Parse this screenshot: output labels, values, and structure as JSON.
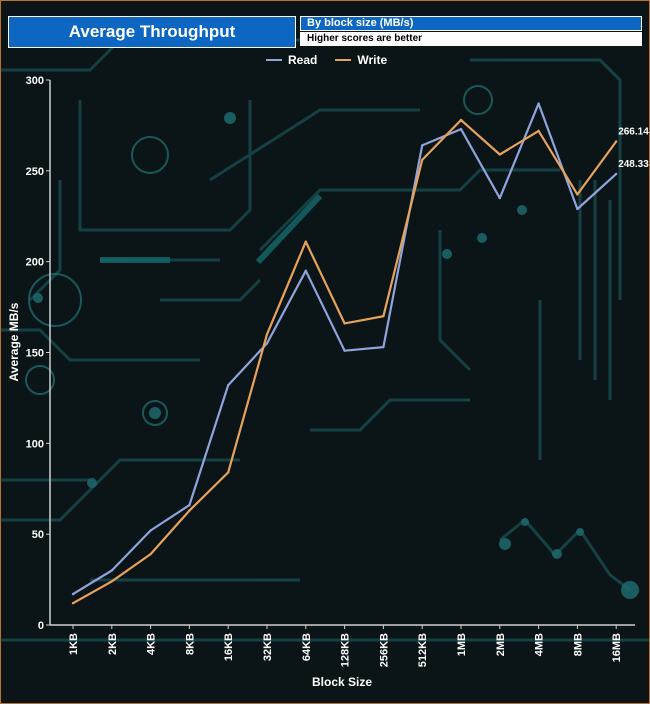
{
  "header": {
    "title": "Average Throughput",
    "subtitle": "By block size (MB/s)",
    "note": "Higher scores are better"
  },
  "colors": {
    "read": "#8fa4dc",
    "write": "#e8a35a",
    "title_bg": "#0d66c2",
    "axis": "#d0d0d0"
  },
  "chart_data": {
    "type": "line",
    "title": "Average Throughput",
    "subtitle": "By block size (MB/s)",
    "xlabel": "Block Size",
    "ylabel": "Average MB/s",
    "ylim": [
      0,
      300
    ],
    "yticks": [
      0,
      50,
      100,
      150,
      200,
      250,
      300
    ],
    "grid": false,
    "legend_position": "top-center",
    "categories": [
      "1KB",
      "2KB",
      "4KB",
      "8KB",
      "16KB",
      "32KB",
      "64KB",
      "128KB",
      "256KB",
      "512KB",
      "1MB",
      "2MB",
      "4MB",
      "8MB",
      "16MB"
    ],
    "series": [
      {
        "name": "Read",
        "values": [
          17,
          30,
          52,
          66,
          132,
          155,
          195,
          151,
          153,
          264,
          273,
          235,
          287,
          229,
          248.33
        ],
        "end_label": "248.33"
      },
      {
        "name": "Write",
        "values": [
          12,
          24,
          39,
          63,
          84,
          160,
          211,
          166,
          170,
          256,
          278,
          259,
          272,
          237,
          266.14
        ],
        "end_label": "266.14"
      }
    ]
  }
}
